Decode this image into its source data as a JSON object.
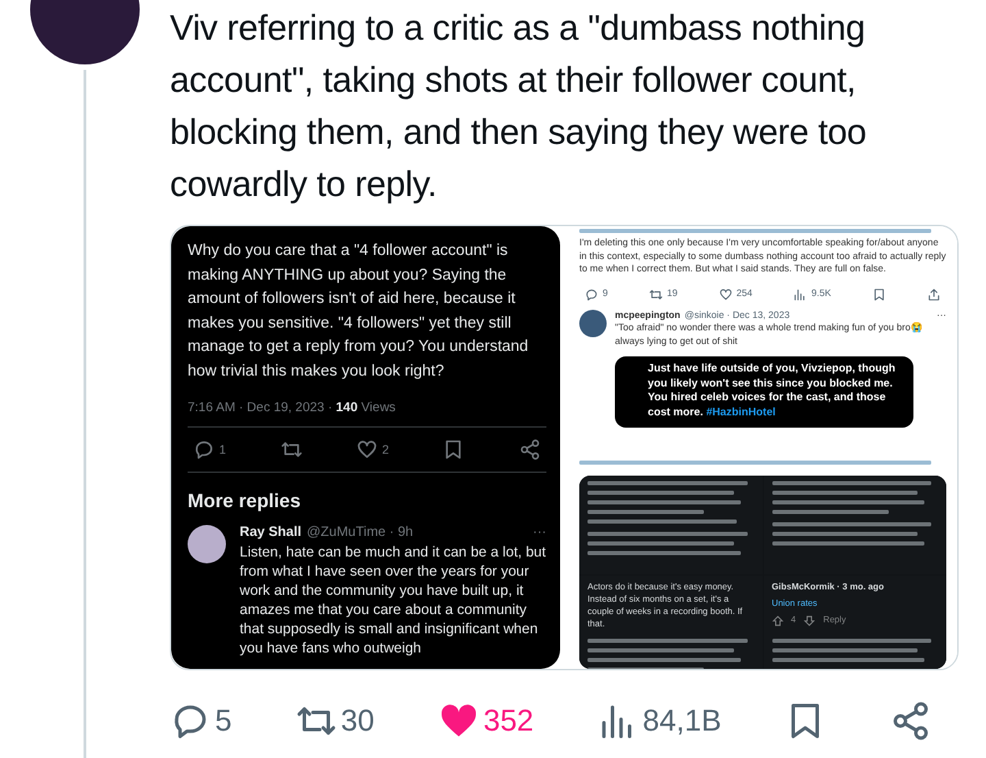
{
  "post": {
    "text": "Viv referring to a critic as a \"dumbass nothing account\", taking shots at their follower count, blocking them, and then saying they were too cowardly to reply.",
    "media": {
      "left": {
        "text": "Why do you care that a \"4 follower account\" is making ANYTHING up about you? Saying the amount of followers isn't of aid here, because it makes you sensitive. \"4 followers\" yet they still manage to get a reply from you? You understand how trivial this makes you look right?",
        "meta": "7:16 AM · Dec 19, 2023 · **140** Views",
        "actions": [
          {
            "kind": "reply",
            "count": "1"
          },
          {
            "kind": "repost"
          },
          {
            "kind": "like",
            "count": "2",
            "liked": false
          },
          {
            "kind": "bookmark"
          },
          {
            "kind": "share"
          }
        ],
        "section_title": "More replies",
        "reply": {
          "name": "Ray Shall",
          "handle": "@ZuMuTime · 9h",
          "more": "···",
          "text": "Listen, hate can be much and it can be a lot, but from what I have seen over the years for your work and the community you have built up, it amazes me that you care about a community that supposedly is small and insignificant when you have fans who outweigh"
        }
      },
      "right_top": {
        "text": "I'm deleting this one only because I'm very uncomfortable speaking for/about anyone in this context, especially to some dumbass nothing account too afraid to actually reply to me when I correct them. But what I said stands. They are full on false.",
        "actions": [
          {
            "kind": "reply",
            "count": "9"
          },
          {
            "kind": "repost",
            "count": "19"
          },
          {
            "kind": "like",
            "count": "254",
            "liked": false
          },
          {
            "kind": "views",
            "count": "9.5K"
          },
          {
            "kind": "bookmark"
          },
          {
            "kind": "upload"
          }
        ],
        "reply": {
          "name": "mcpeepington",
          "handle": "@sinkoie · Dec 13, 2023",
          "more": "···",
          "text": "\"Too afraid\" no wonder there was a whole trend making fun of you bro😭 always lying to get out of shit",
          "image_text": "Just have life outside of you, Vivziepop, though you likely won't see this since you blocked me. You hired celeb voices for the cast, and those cost more.",
          "hashtag": "#HazbinHotel"
        }
      },
      "right_bottom": {
        "quote": "Actors do it because it's easy money. Instead of six months on a set, it's a couple of weeks in a recording booth. If that.",
        "commenter": "GibsMcKormik · 3 mo. ago",
        "comment": "Union rates",
        "votes": "4",
        "reply_label": "Reply"
      }
    },
    "actions": [
      {
        "kind": "reply",
        "count": "5"
      },
      {
        "kind": "repost",
        "count": "30"
      },
      {
        "kind": "like",
        "count": "352",
        "liked": true
      },
      {
        "kind": "views",
        "count": "84,1B"
      },
      {
        "kind": "bookmark"
      },
      {
        "kind": "share"
      }
    ]
  }
}
